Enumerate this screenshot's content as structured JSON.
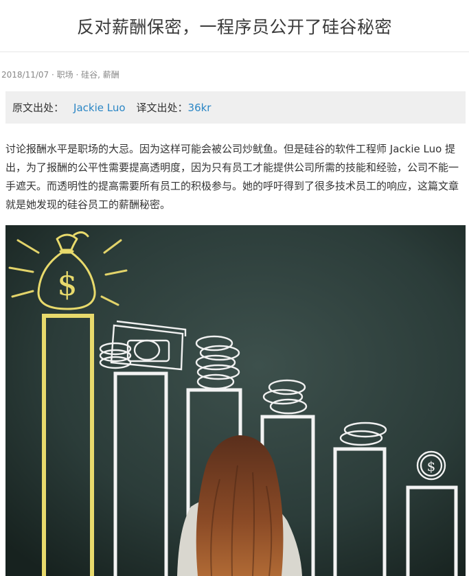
{
  "article": {
    "title": "反对薪酬保密，一程序员公开了硅谷秘密",
    "meta": {
      "date": "2018/11/07",
      "separator": " · ",
      "category": "职场",
      "tags": [
        "硅谷",
        "薪酬"
      ]
    },
    "source": {
      "original_label": "原文出处：",
      "original_author": "Jackie Luo",
      "translation_label": "译文出处：",
      "translation_source": "36kr"
    },
    "intro": "讨论报酬水平是职场的大忌。因为这样可能会被公司炒鱿鱼。但是硅谷的软件工程师 Jackie Luo 提出，为了报酬的公平性需要提高透明度，因为只有员工才能提供公司所需的技能和经验，公司不能一手遮天。而透明性的提高需要所有员工的积极参与。她的呼吁得到了很多技术员工的响应，这篇文章就是她发现的硅谷员工的薪酬秘密。",
    "hero_image": {
      "money_symbol": "$"
    }
  }
}
